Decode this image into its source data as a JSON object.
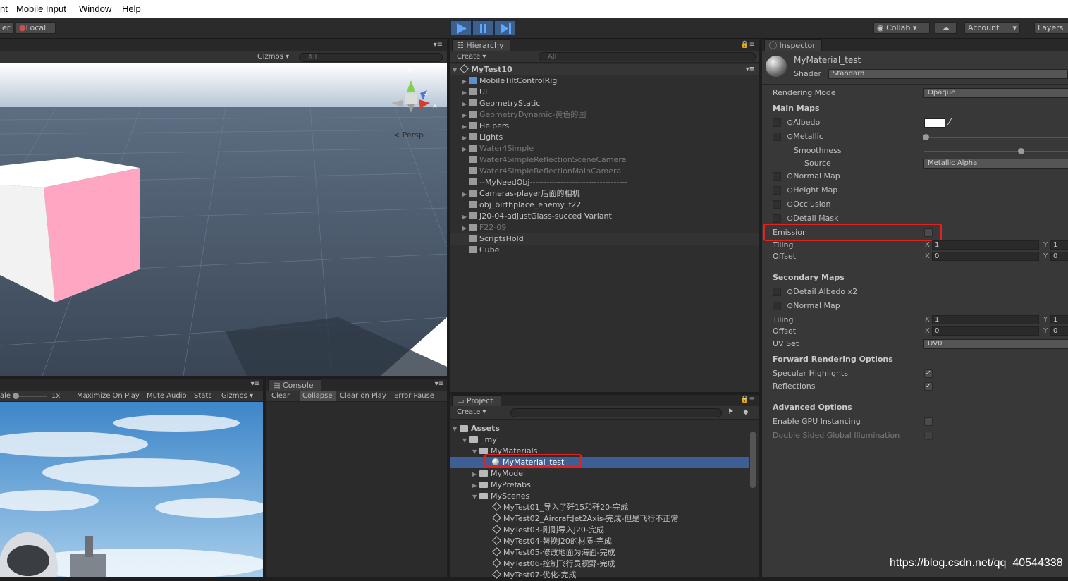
{
  "menubar": {
    "items": [
      "nt",
      "Mobile Input",
      "Window",
      "Help"
    ]
  },
  "toolbar": {
    "pivot_label": "er",
    "local_label": "Local",
    "collab_label": "Collab",
    "account_label": "Account",
    "layers_label": "Layers"
  },
  "scene": {
    "gizmos_label": "Gizmos",
    "search_placeholder": "All",
    "persp_label": "Persp",
    "axis_y": "y",
    "axis_x": "x",
    "axis_z": "z"
  },
  "game": {
    "scale_label": "ale",
    "scale_value": "1x",
    "maximize_label": "Maximize On Play",
    "mute_label": "Mute Audio",
    "stats_label": "Stats",
    "gizmos_label": "Gizmos"
  },
  "console": {
    "tab_label": "Console",
    "clear_label": "Clear",
    "collapse_label": "Collapse",
    "clear_on_play_label": "Clear on Play",
    "error_pause_label": "Error Pause"
  },
  "hierarchy": {
    "tab_label": "Hierarchy",
    "create_label": "Create",
    "search_placeholder": "All",
    "scene_name": "MyTest10",
    "items": [
      {
        "label": "MobileTiltControlRig",
        "arrow": "▶",
        "dim": false
      },
      {
        "label": "UI",
        "arrow": "▶",
        "dim": false
      },
      {
        "label": "GeometryStatic",
        "arrow": "▶",
        "dim": false
      },
      {
        "label": "GeometryDynamic-黄色的围",
        "arrow": "▶",
        "dim": true
      },
      {
        "label": "Helpers",
        "arrow": "▶",
        "dim": false
      },
      {
        "label": "Lights",
        "arrow": "▶",
        "dim": false
      },
      {
        "label": "Water4Simple",
        "arrow": "▶",
        "dim": true
      },
      {
        "label": "Water4SimpleReflectionSceneCamera",
        "arrow": "",
        "dim": true
      },
      {
        "label": "Water4SimpleReflectionMainCamera",
        "arrow": "",
        "dim": true
      },
      {
        "label": "--MyNeedObj-----------------------------------",
        "arrow": "",
        "dim": false
      },
      {
        "label": "Cameras-player后面的相机",
        "arrow": "▶",
        "dim": false
      },
      {
        "label": "obj_birthplace_enemy_f22",
        "arrow": "",
        "dim": false
      },
      {
        "label": "J20-04-adjustGlass-succed Variant",
        "arrow": "▶",
        "dim": false
      },
      {
        "label": "F22-09",
        "arrow": "▶",
        "dim": true
      },
      {
        "label": "ScriptsHold",
        "arrow": "",
        "dim": false
      },
      {
        "label": "Cube",
        "arrow": "",
        "dim": false
      }
    ]
  },
  "project": {
    "tab_label": "Project",
    "create_label": "Create",
    "assets_label": "Assets",
    "my_label": "_my",
    "materials_label": "MyMaterials",
    "material_item": "MyMaterial_test",
    "model_label": "MyModel",
    "prefabs_label": "MyPrefabs",
    "scenes_label": "MyScenes",
    "scenes": [
      "MyTest01_导入了歼15和歼20-完成",
      "MyTest02_AircraftJet2Axis-完成-但是飞行不正常",
      "MyTest03-刚刚导入J20-完成",
      "MyTest04-替换J20的材质-完成",
      "MyTest05-修改地面为海面-完成",
      "MyTest06-控制飞行员视野-完成",
      "MyTest07-优化-完成"
    ]
  },
  "inspector": {
    "tab_label": "Inspector",
    "material_name": "MyMaterial_test",
    "shader_label": "Shader",
    "shader_value": "Standard",
    "rendering_mode_label": "Rendering Mode",
    "rendering_mode_value": "Opaque",
    "main_maps_label": "Main Maps",
    "albedo_label": "Albedo",
    "metallic_label": "Metallic",
    "smoothness_label": "Smoothness",
    "source_label": "Source",
    "source_value": "Metallic Alpha",
    "normal_map_label": "Normal Map",
    "height_map_label": "Height Map",
    "occlusion_label": "Occlusion",
    "detail_mask_label": "Detail Mask",
    "emission_label": "Emission",
    "tiling_label": "Tiling",
    "offset_label": "Offset",
    "x_label": "X",
    "y_label": "Y",
    "main_tiling_x": "1",
    "main_tiling_y": "1",
    "main_offset_x": "0",
    "main_offset_y": "0",
    "secondary_maps_label": "Secondary Maps",
    "detail_albedo_label": "Detail Albedo x2",
    "secondary_normal_label": "Normal Map",
    "sec_tiling_x": "1",
    "sec_tiling_y": "1",
    "sec_offset_x": "0",
    "sec_offset_y": "0",
    "uv_set_label": "UV Set",
    "uv_set_value": "UV0",
    "forward_label": "Forward Rendering Options",
    "specular_label": "Specular Highlights",
    "reflections_label": "Reflections",
    "advanced_label": "Advanced Options",
    "gpu_instancing_label": "Enable GPU Instancing",
    "double_sided_label": "Double Sided Global Illumination",
    "check_mark": "✓"
  },
  "watermark": "https://blog.csdn.net/qq_40544338",
  "colors": {
    "highlight_red": "#e22121",
    "selection_blue": "#3e5f96",
    "play_blue": "#3d5f8c"
  }
}
